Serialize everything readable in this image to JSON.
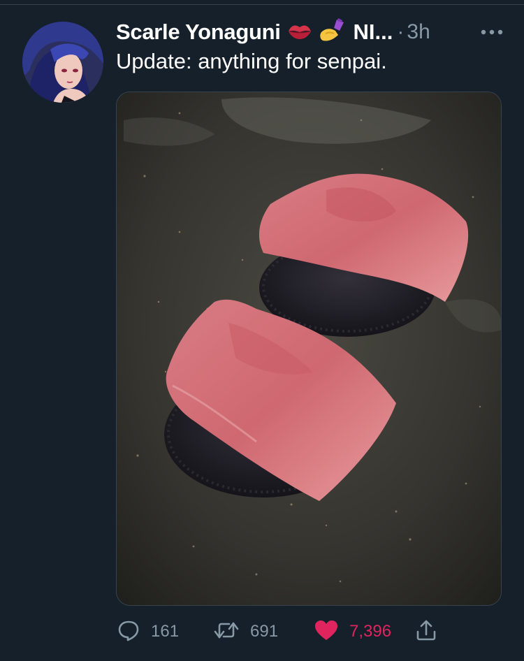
{
  "tweet": {
    "author_name": "Scarle Yonaguni",
    "author_name_suffix": "NI...",
    "separator": "·",
    "timestamp": "3h",
    "text": "Update: anything for senpai."
  },
  "icons": {
    "more": "more-horizontal-icon",
    "reply": "reply-icon",
    "retweet": "retweet-icon",
    "like": "heart-icon",
    "share": "share-icon",
    "emoji1": "kiss-mark-emoji-icon",
    "emoji2": "nail-polish-emoji-icon"
  },
  "actions": {
    "reply_count": "161",
    "retweet_count": "691",
    "like_count": "7,396"
  },
  "colors": {
    "background": "#15202b",
    "secondary_text": "#8899a6",
    "like": "#e0245e",
    "divider": "#38444d"
  }
}
